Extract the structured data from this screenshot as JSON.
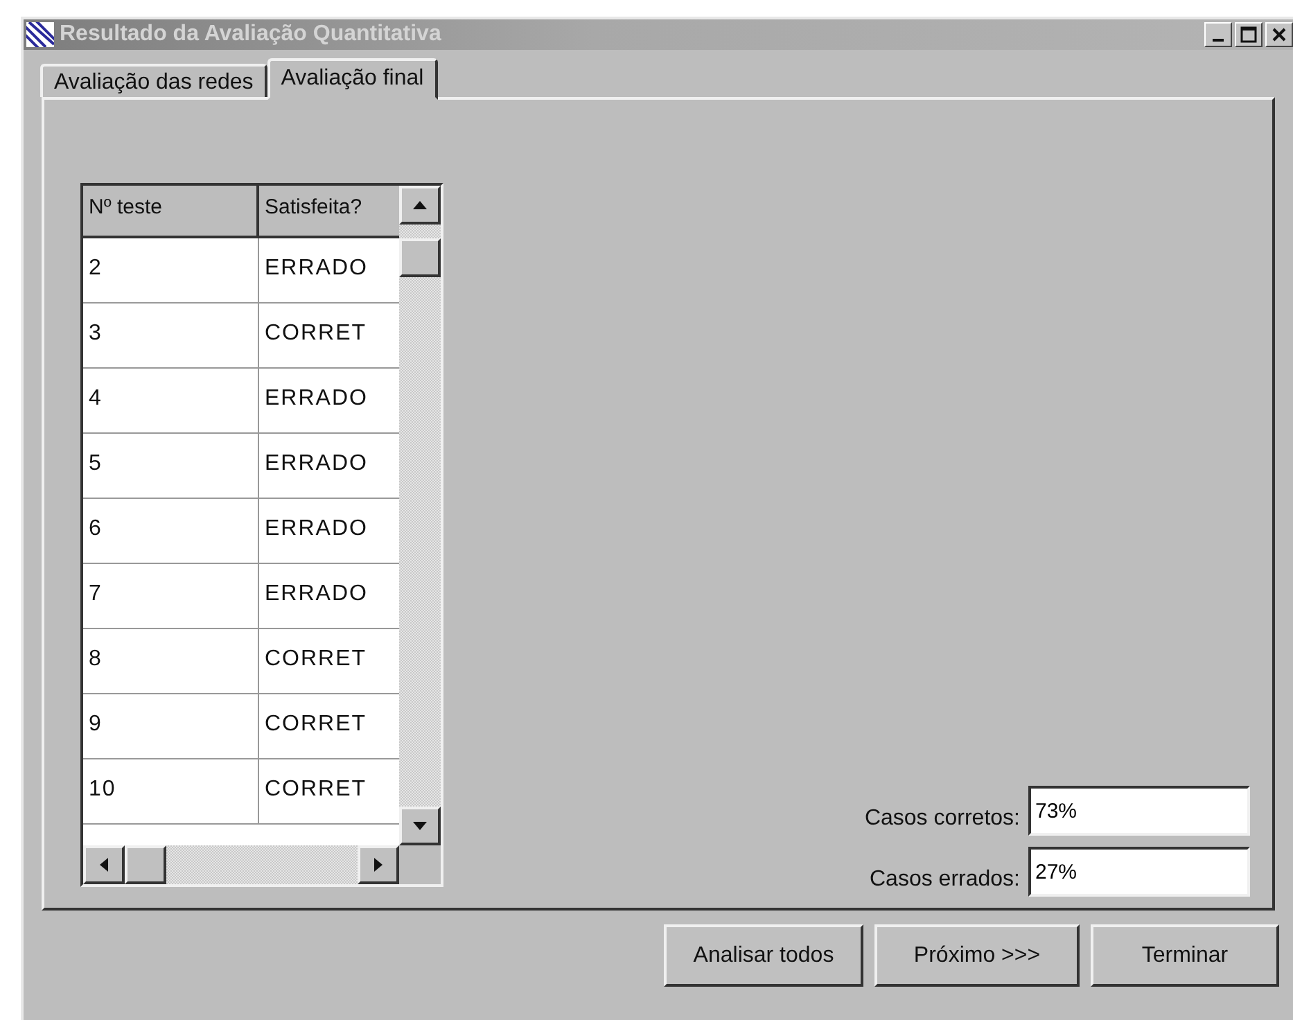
{
  "window": {
    "title": "Resultado da Avaliação Quantitativa"
  },
  "tabs": [
    {
      "label": "Avaliação das redes",
      "selected": false
    },
    {
      "label": "Avaliação final",
      "selected": true
    }
  ],
  "table": {
    "columns": [
      "Nº teste",
      "Satisfeita?"
    ],
    "rows": [
      [
        "2",
        "ERRADO"
      ],
      [
        "3",
        "CORRET"
      ],
      [
        "4",
        "ERRADO"
      ],
      [
        "5",
        "ERRADO"
      ],
      [
        "6",
        "ERRADO"
      ],
      [
        "7",
        "ERRADO"
      ],
      [
        "8",
        "CORRET"
      ],
      [
        "9",
        "CORRET"
      ],
      [
        "10",
        "CORRET"
      ]
    ]
  },
  "results": [
    {
      "label": "Casos corretos:",
      "value": "73%"
    },
    {
      "label": "Casos errados:",
      "value": "27%"
    }
  ],
  "buttons": [
    "Analisar todos",
    "Próximo >>>",
    "Terminar"
  ]
}
